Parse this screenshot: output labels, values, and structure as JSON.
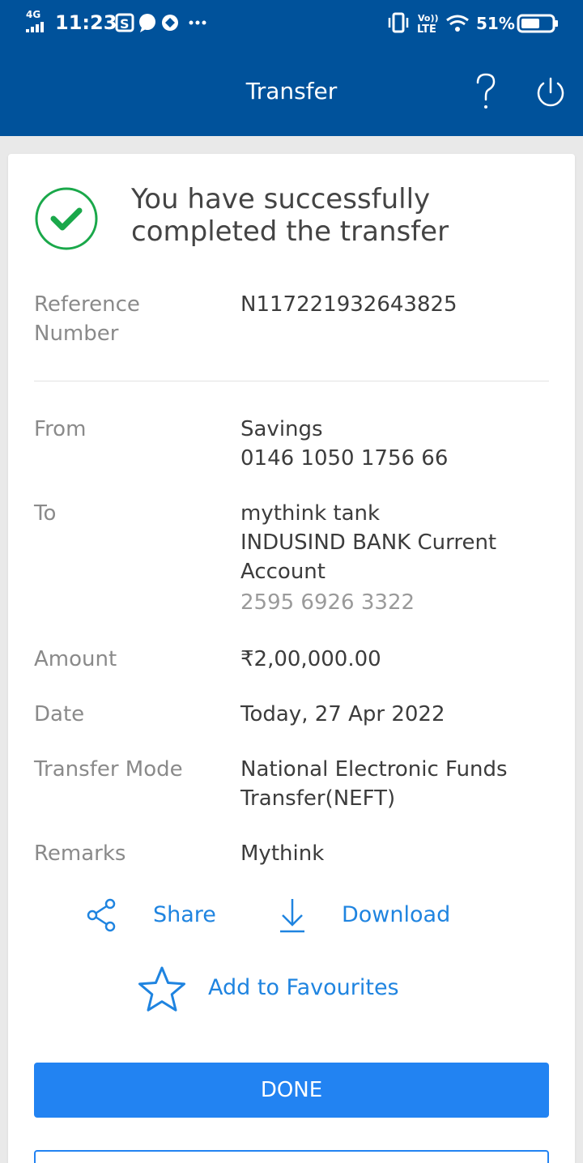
{
  "status_bar": {
    "network": "4G",
    "time": "11:23",
    "volte": "Vo))",
    "lte": "LTE",
    "battery": "51%"
  },
  "header": {
    "title": "Transfer",
    "help_icon": "question-icon",
    "power_icon": "power-icon",
    "color": "#00529b"
  },
  "success": {
    "icon": "check-circle-icon",
    "message": "You have successfully completed the transfer",
    "color": "#1aa84a"
  },
  "details": {
    "reference": {
      "label": "Reference Number",
      "value": "N117221932643825"
    },
    "from": {
      "label": "From",
      "line1": "Savings",
      "line2": "0146 1050 1756 66"
    },
    "to": {
      "label": "To",
      "line1": "mythink tank",
      "line2": "INDUSIND BANK Current Account",
      "line3": "2595 6926 3322"
    },
    "amount": {
      "label": "Amount",
      "value": "₹2,00,000.00"
    },
    "date": {
      "label": "Date",
      "value": "Today, 27 Apr 2022"
    },
    "mode": {
      "label": "Transfer Mode",
      "value": "National Electronic Funds Transfer(NEFT)"
    },
    "remarks": {
      "label": "Remarks",
      "value": "Mythink"
    }
  },
  "actions": {
    "share": "Share",
    "download": "Download",
    "favourites": "Add to Favourites",
    "done": "DONE",
    "accent": "#2283f2"
  }
}
